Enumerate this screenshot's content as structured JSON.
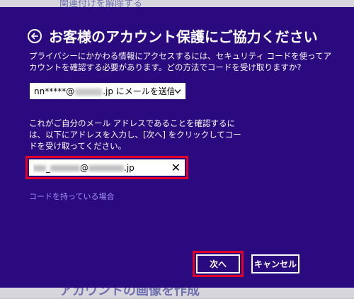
{
  "background": {
    "top_text": "関連付けを解除する",
    "bottom_text": "アカウントの画像を作成"
  },
  "dialog": {
    "title": "お客様のアカウント保護にご協力ください",
    "description": "プライバシーにかかわる情報にアクセスするには、セキュリティ コードを使ってアカウントを確認する必要があります。どの方法でコードを受け取りますか?",
    "method_select": {
      "prefix": "nn*****@",
      "suffix": ".jp にメールを送信"
    },
    "instruction": "これがご自分のメール アドレスであることを確認するには、以下にアドレスを入力し、[次へ] をクリックしてコードを受け取ってください。",
    "email_field": {
      "middle": "_",
      "at": "@",
      "suffix": ".jp",
      "clear_label": "✕"
    },
    "have_code_link": "コードを持っている場合",
    "next_button": "次へ",
    "cancel_button": "キャンセル"
  },
  "colors": {
    "dialog_bg": "#2a0a7e",
    "highlight": "#e0002a",
    "link": "#a28ff0"
  }
}
